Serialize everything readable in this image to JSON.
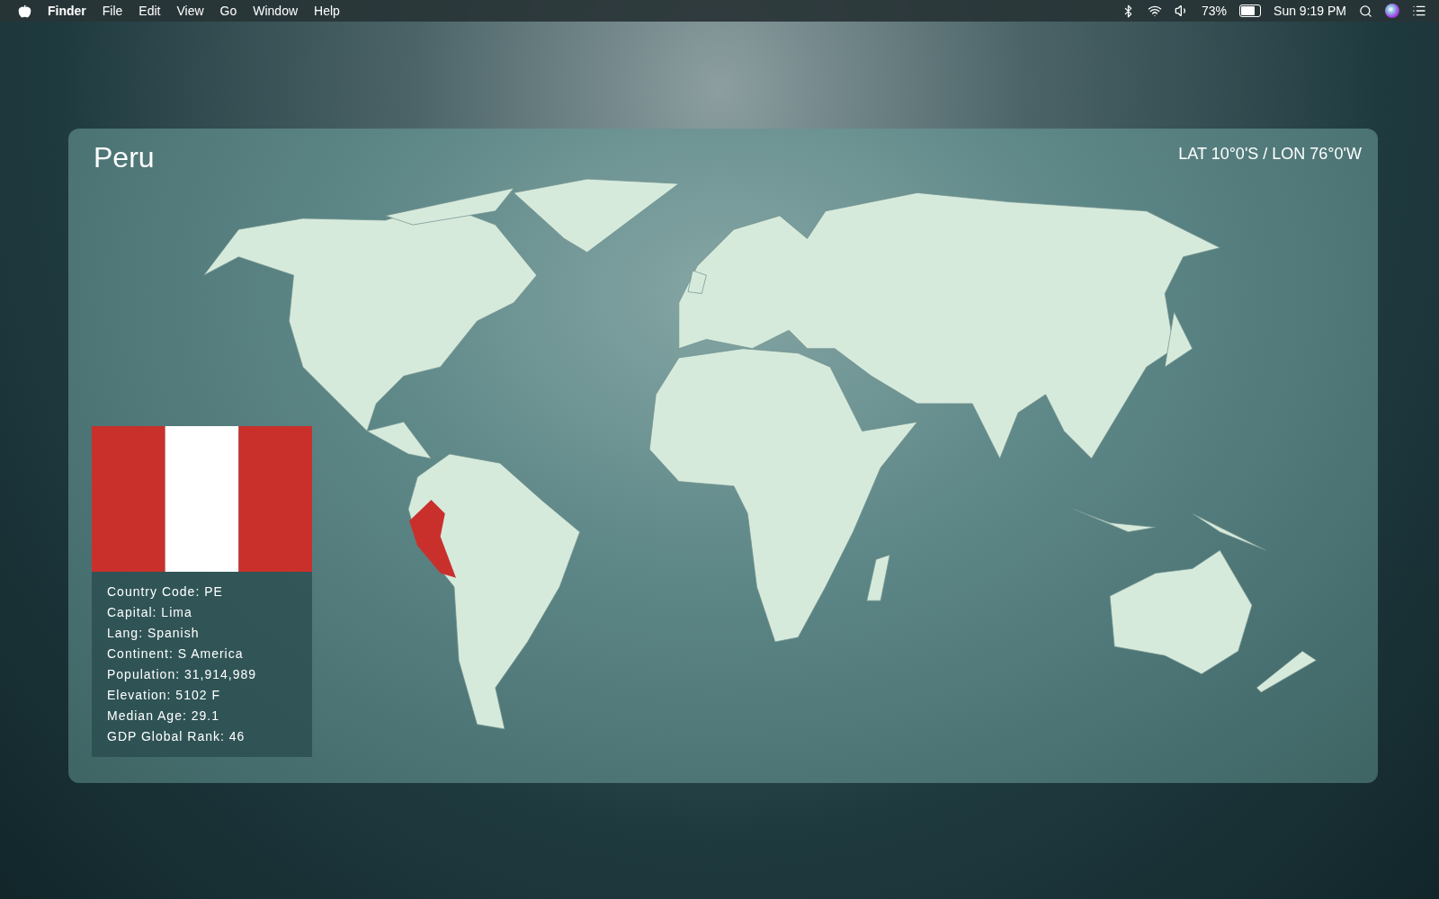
{
  "menu_bar": {
    "app_name": "Finder",
    "menus": [
      "File",
      "Edit",
      "View",
      "Go",
      "Window",
      "Help"
    ],
    "battery_percent": "73%",
    "clock": "Sun 9:19 PM"
  },
  "window": {
    "title": "Peru",
    "coordinates": "LAT 10°0'S / LON 76°0'W"
  },
  "country_info": [
    "Country Code: PE",
    "Capital: Lima",
    "Lang: Spanish",
    "Continent: S America",
    "Population: 31,914,989",
    "Elevation: 5102 F",
    "Median Age: 29.1",
    "GDP Global Rank: 46"
  ]
}
